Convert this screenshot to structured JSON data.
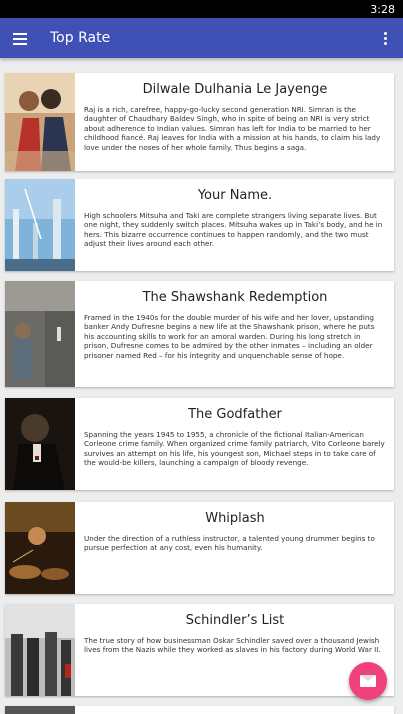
{
  "status": {
    "time": "3:28"
  },
  "appbar": {
    "title": "Top Rate",
    "menu_icon": "hamburger-menu-icon",
    "overflow_icon": "more-vert-icon",
    "color": "#3f51b5"
  },
  "movies": [
    {
      "title": "Dilwale Dulhania Le Jayenge",
      "overview": "Raj is a rich, carefree, happy-go-lucky second generation NRI. Simran is the daughter of Chaudhary Baldev Singh, who in spite of being an NRI is very strict about adherence to Indian values. Simran has left for India to be married to her childhood fiancé. Raj leaves for India with a mission at his hands, to claim his lady love under the noses of her whole family. Thus begins a saga."
    },
    {
      "title": "Your Name.",
      "overview": "High schoolers Mitsuha and Taki are complete strangers living separate lives. But one night, they suddenly switch places. Mitsuha wakes up in Taki’s body, and he in hers. This bizarre occurrence continues to happen randomly, and the two must adjust their lives around each other."
    },
    {
      "title": "The Shawshank Redemption",
      "overview": "Framed in the 1940s for the double murder of his wife and her lover, upstanding banker Andy Dufresne begins a new life at the Shawshank prison, where he puts his accounting skills to work for an amoral warden. During his long stretch in prison, Dufresne comes to be admired by the other inmates – including an older prisoner named Red – for his integrity and unquenchable sense of hope."
    },
    {
      "title": "The Godfather",
      "overview": "Spanning the years 1945 to 1955, a chronicle of the fictional Italian-American Corleone crime family. When organized crime family patriarch, Vito Corleone barely survives an attempt on his life, his youngest son, Michael steps in to take care of the would-be killers, launching a campaign of bloody revenge."
    },
    {
      "title": "Whiplash",
      "overview": "Under the direction of a ruthless instructor, a talented young drummer begins to pursue perfection at any cost, even his humanity."
    },
    {
      "title": "Schindler’s List",
      "overview": "The true story of how businessman Oskar Schindler saved over a thousand Jewish lives from the Nazis while they worked as slaves in his factory during World War II."
    }
  ],
  "fab": {
    "icon": "email-icon",
    "color": "#f0417a"
  }
}
